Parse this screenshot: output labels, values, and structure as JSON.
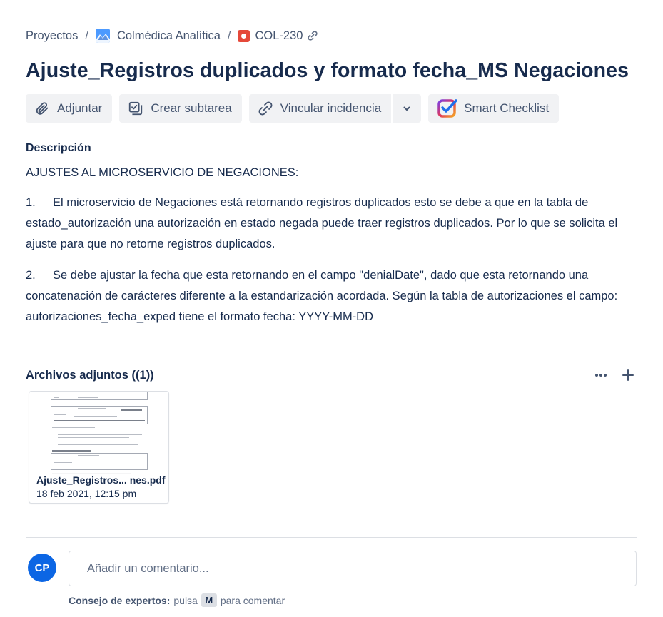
{
  "breadcrumb": {
    "root": "Proyectos",
    "separator": "/",
    "project": "Colmédica Analítica",
    "issue_key": "COL-230"
  },
  "issue": {
    "title": "Ajuste_Registros duplicados y formato fecha_MS Negaciones"
  },
  "toolbar": {
    "attach_label": "Adjuntar",
    "subtask_label": "Crear subtarea",
    "link_label": "Vincular incidencia",
    "checklist_label": "Smart Checklist"
  },
  "description": {
    "label": "Descripción",
    "heading": "AJUSTES AL MICROSERVICIO DE NEGACIONES:",
    "items": [
      {
        "num": "1.",
        "text": "El microservicio de Negaciones está retornando registros duplicados esto se debe a que en la tabla de estado_autorización una autorización en estado negada puede traer registros duplicados. Por lo que se solicita el ajuste para que no retorne registros duplicados."
      },
      {
        "num": "2.",
        "text": "Se debe ajustar la fecha que esta retornando en el campo \"denialDate\", dado que esta retornando una concatenación de carácteres diferente a la estandarización acordada. Según la tabla de autorizaciones el campo: autorizaciones_fecha_exped tiene el formato fecha: YYYY-MM-DD"
      }
    ]
  },
  "attachments": {
    "label": "Archivos adjuntos ((1))",
    "files": [
      {
        "name": "Ajuste_Registros... nes.pdf",
        "date": "18 feb 2021, 12:15 pm"
      }
    ]
  },
  "comment": {
    "avatar_initials": "CP",
    "placeholder": "Añadir un comentario...",
    "tip_label": "Consejo de expertos:",
    "tip_text_before": "pulsa",
    "tip_key": "M",
    "tip_text_after": "para comentar"
  },
  "colors": {
    "text_primary": "#172b4d",
    "text_subtle": "#44546f",
    "button_bg": "#f1f2f4",
    "avatar_bg": "#0c66e4",
    "issue_type": "#e5493a",
    "project_icon": "#4c9aff"
  },
  "icons": {
    "project": "project-avatar-icon",
    "issue_type": "bug-icon",
    "permalink": "link-icon",
    "attach": "paperclip-icon",
    "subtask": "subtask-icon",
    "link_issue": "link-icon",
    "dropdown": "chevron-down-icon",
    "checklist": "smart-checklist-icon",
    "more": "more-icon",
    "add": "plus-icon"
  }
}
